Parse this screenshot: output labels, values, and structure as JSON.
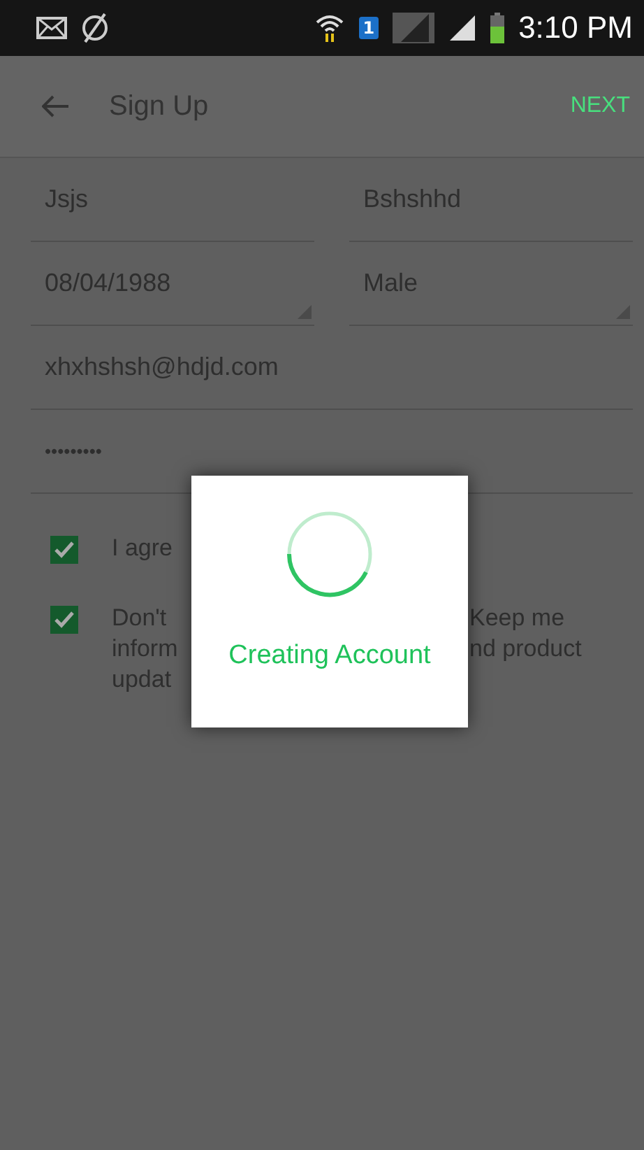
{
  "status_bar": {
    "time": "3:10 PM",
    "sim_badge": "1"
  },
  "app_bar": {
    "title": "Sign Up",
    "action": "NEXT"
  },
  "field_rows": [
    [
      {
        "kind": "text",
        "value": "Jsjs"
      },
      {
        "kind": "text",
        "value": "Bshshhd"
      }
    ],
    [
      {
        "kind": "dropdown",
        "value": "08/04/1988"
      },
      {
        "kind": "dropdown",
        "value": "Male"
      }
    ],
    [
      {
        "kind": "text",
        "value": "xhxhshsh@hdjd.com"
      }
    ],
    [
      {
        "kind": "password",
        "value": "•••••••••"
      }
    ]
  ],
  "checkboxes": [
    {
      "checked": true,
      "left_lines": [
        "I agre"
      ]
    },
    {
      "checked": true,
      "left_lines": [
        "Don't",
        "inform",
        "updat"
      ],
      "right_lines": [
        "Keep me",
        "nd product"
      ]
    }
  ],
  "dialog": {
    "message": "Creating Account"
  }
}
